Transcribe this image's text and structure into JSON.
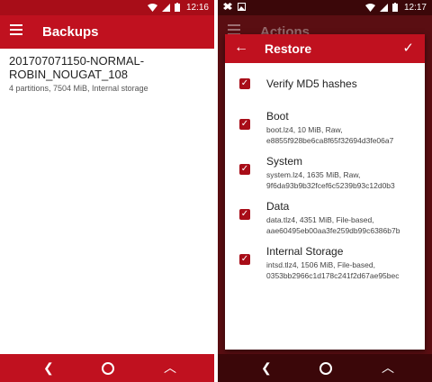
{
  "left": {
    "status": {
      "time": "12:16"
    },
    "appbar": {
      "title": "Backups"
    },
    "backup": {
      "name_line1": "201707071150-NORMAL-",
      "name_line2": "ROBIN_NOUGAT_108",
      "meta": "4 partitions, 7504 MiB, Internal storage"
    }
  },
  "right": {
    "status": {
      "time": "12:17"
    },
    "appbar": {
      "title": "Actions"
    },
    "dialog": {
      "title": "Restore",
      "options": [
        {
          "label": "Verify MD5 hashes",
          "detail1": "",
          "detail2": ""
        },
        {
          "label": "Boot",
          "detail1": "boot.lz4, 10 MiB, Raw,",
          "detail2": "e8855f928be6ca8f65f32694d3fe06a7"
        },
        {
          "label": "System",
          "detail1": "system.lz4, 1635 MiB, Raw,",
          "detail2": "9f6da93b9b32fcef6c5239b93c12d0b3"
        },
        {
          "label": "Data",
          "detail1": "data.tlz4, 4351 MiB, File-based,",
          "detail2": "aae60495eb00aa3fe259db99c6386b7b"
        },
        {
          "label": "Internal Storage",
          "detail1": "intsd.tlz4, 1506 MiB, File-based,",
          "detail2": "0353bb2966c1d178c241f2d67ae95bec"
        }
      ]
    }
  },
  "icons": {
    "menu": "hamburger-icon",
    "back": "arrow-left-icon",
    "confirm": "check-icon",
    "checkbox": "checkbox-checked-icon"
  },
  "colors": {
    "primary": "#c0111f",
    "primary_dark": "#a80d18",
    "dimmed_background": "#5a0e12"
  }
}
